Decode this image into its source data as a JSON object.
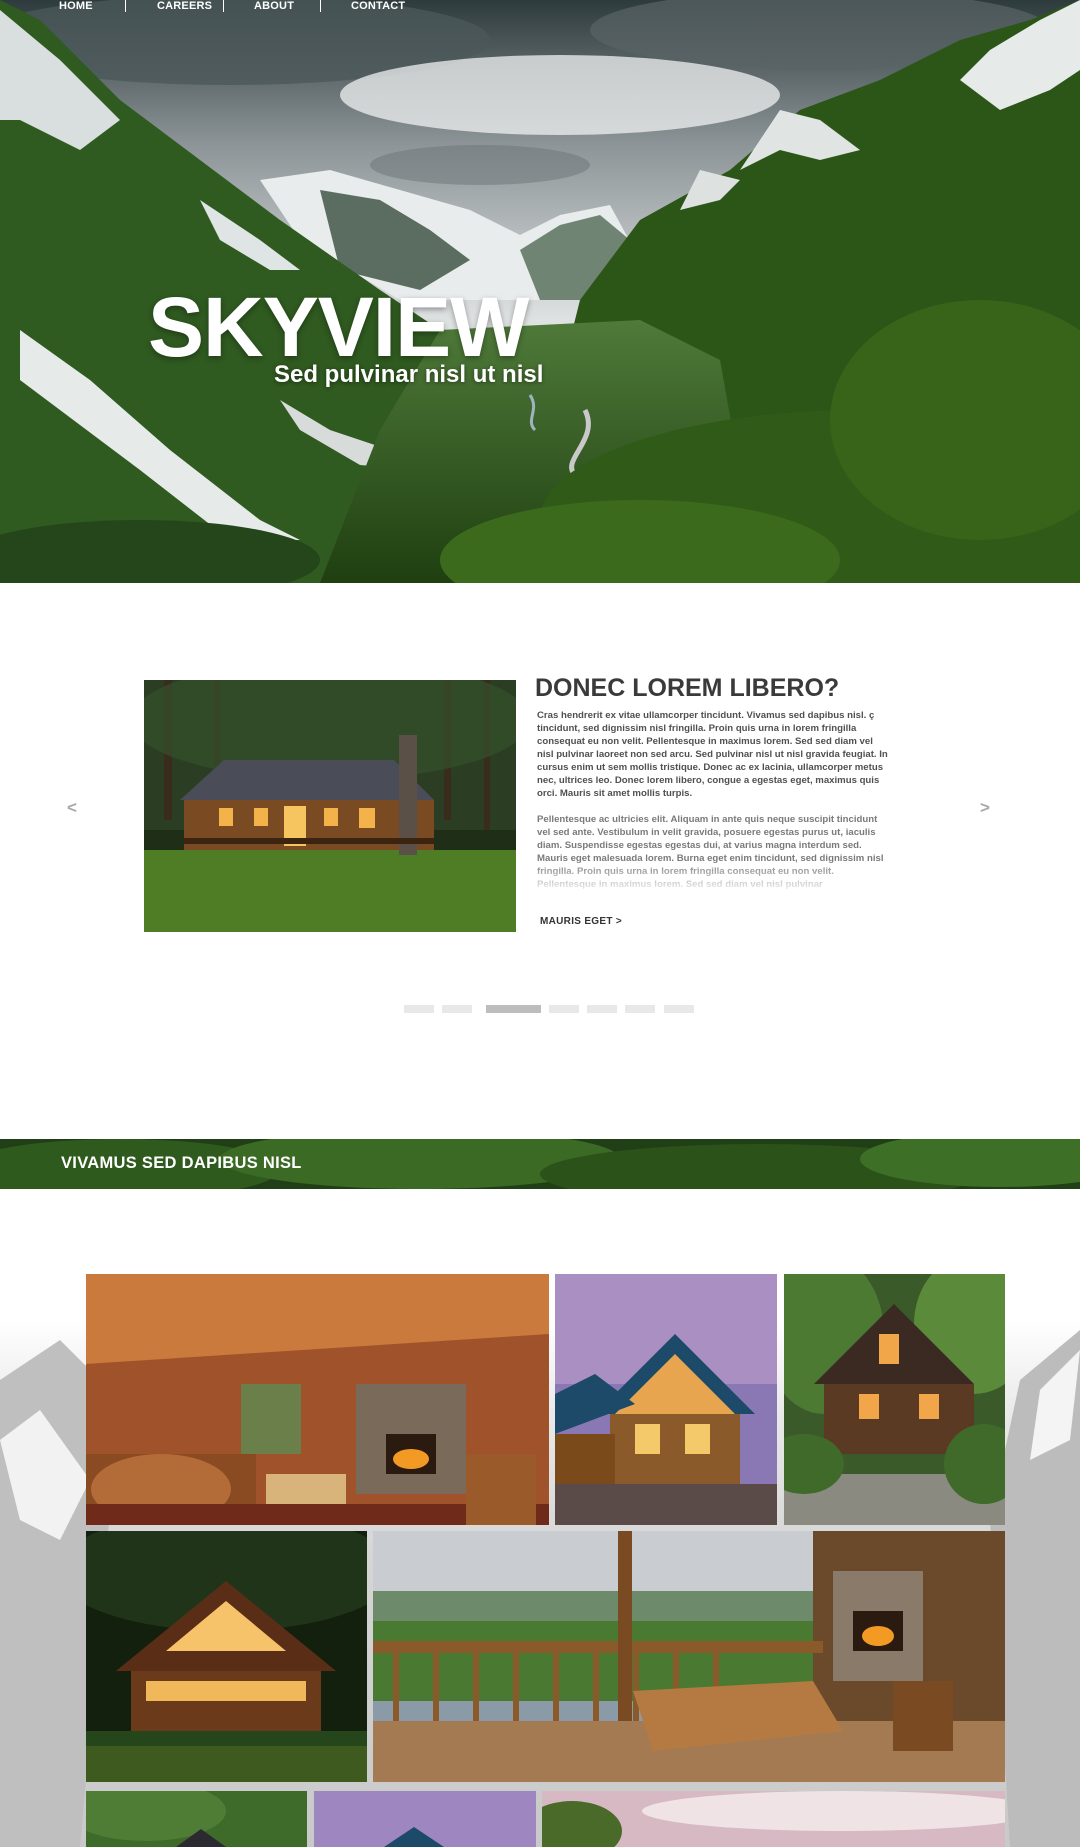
{
  "nav": {
    "items": [
      "HOME",
      "CAREERS",
      "ABOUT",
      "CONTACT"
    ]
  },
  "hero": {
    "title": "SKYVIEW",
    "subtitle": "Sed pulvinar nisl ut nisl"
  },
  "slider": {
    "prev_label": "<",
    "next_label": ">",
    "heading": "DONEC LOREM LIBERO?",
    "paragraph_1": "Cras hendrerit ex vitae ullamcorper tincidunt. Vivamus sed dapibus nisl. ç tincidunt, sed dignissim nisl fringilla. Proin quis urna in lorem fringilla consequat eu non velit. Pellentesque in maximus lorem. Sed sed diam vel nisl pulvinar laoreet non sed arcu. Sed pulvinar nisl ut nisl gravida feugiat. In cursus enim ut sem mollis tristique. Donec ac ex lacinia, ullamcorper metus nec, ultrices leo. Donec lorem libero, congue a egestas eget, maximus quis orci. Mauris sit amet mollis turpis.",
    "paragraph_2": "Pellentesque ac ultricies elit. Aliquam in ante quis neque suscipit tincidunt vel sed ante. Vestibulum in velit gravida, posuere egestas purus ut, iaculis diam. Suspendisse egestas egestas dui, at varius magna interdum sed. Mauris eget malesuada lorem. Burna eget enim tincidunt, sed dignissim nisl fringilla. Proin quis urna in lorem fringilla consequat eu non velit. Pellentesque in maximus lorem. Sed sed diam vel nisl pulvinar",
    "link_label": "MAURIS EGET >",
    "dot_count": 7,
    "active_dot": 3
  },
  "banner": {
    "title": "VIVAMUS SED DAPIBUS NISL"
  },
  "colors": {
    "text_dark": "#3a3a3a",
    "dot_inactive": "#e8e8e8",
    "dot_active": "#bdbdbd",
    "forest_green": "#2f5a1e"
  },
  "gallery": {
    "images": [
      "cabin-interior-living-room",
      "cabin-exterior-dusk",
      "cabin-in-forest",
      "cabin-at-night",
      "deck-mountain-view",
      "cabin-forest-partial",
      "cabin-dusk-partial",
      "sky-view-partial"
    ]
  }
}
